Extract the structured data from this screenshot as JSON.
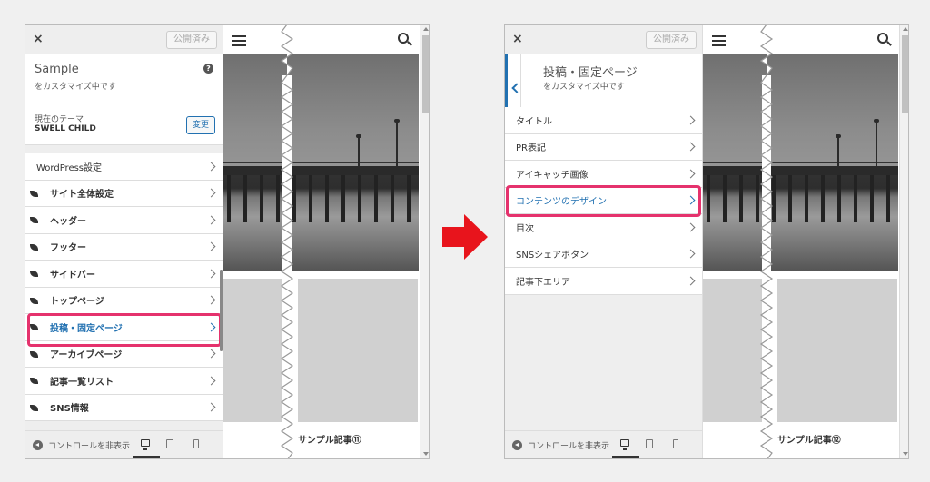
{
  "left": {
    "topbar": {
      "close": "×",
      "publish": "公開済み"
    },
    "header": {
      "title": "Sample",
      "subtitle": "をカスタマイズ中です"
    },
    "theme": {
      "label": "現在のテーマ",
      "name": "SWELL CHILD",
      "change": "変更"
    },
    "menu": [
      {
        "label": "WordPress設定",
        "plain": true
      },
      {
        "label": "サイト全体設定"
      },
      {
        "label": "ヘッダー"
      },
      {
        "label": "フッター"
      },
      {
        "label": "サイドバー"
      },
      {
        "label": "トップページ"
      },
      {
        "label": "投稿・固定ページ",
        "active": true
      },
      {
        "label": "アーカイブページ"
      },
      {
        "label": "記事一覧リスト"
      },
      {
        "label": "SNS情報"
      }
    ],
    "bottom": {
      "collapse": "コントロールを非表示"
    },
    "post_title": "サンプル記事⑪"
  },
  "right": {
    "topbar": {
      "close": "×",
      "publish": "公開済み"
    },
    "header": {
      "title": "投稿・固定ページ",
      "subtitle": "をカスタマイズ中です"
    },
    "menu": [
      {
        "label": "タイトル"
      },
      {
        "label": "PR表記"
      },
      {
        "label": "アイキャッチ画像"
      },
      {
        "label": "コンテンツのデザイン",
        "active": true
      },
      {
        "label": "目次"
      },
      {
        "label": "SNSシェアボタン"
      },
      {
        "label": "記事下エリア"
      }
    ],
    "bottom": {
      "collapse": "コントロールを非表示"
    },
    "post_title": "サンプル記事⑫"
  },
  "colors": {
    "highlight": "#e5326d",
    "accent": "#2271b1",
    "arrow": "#e8141c"
  }
}
